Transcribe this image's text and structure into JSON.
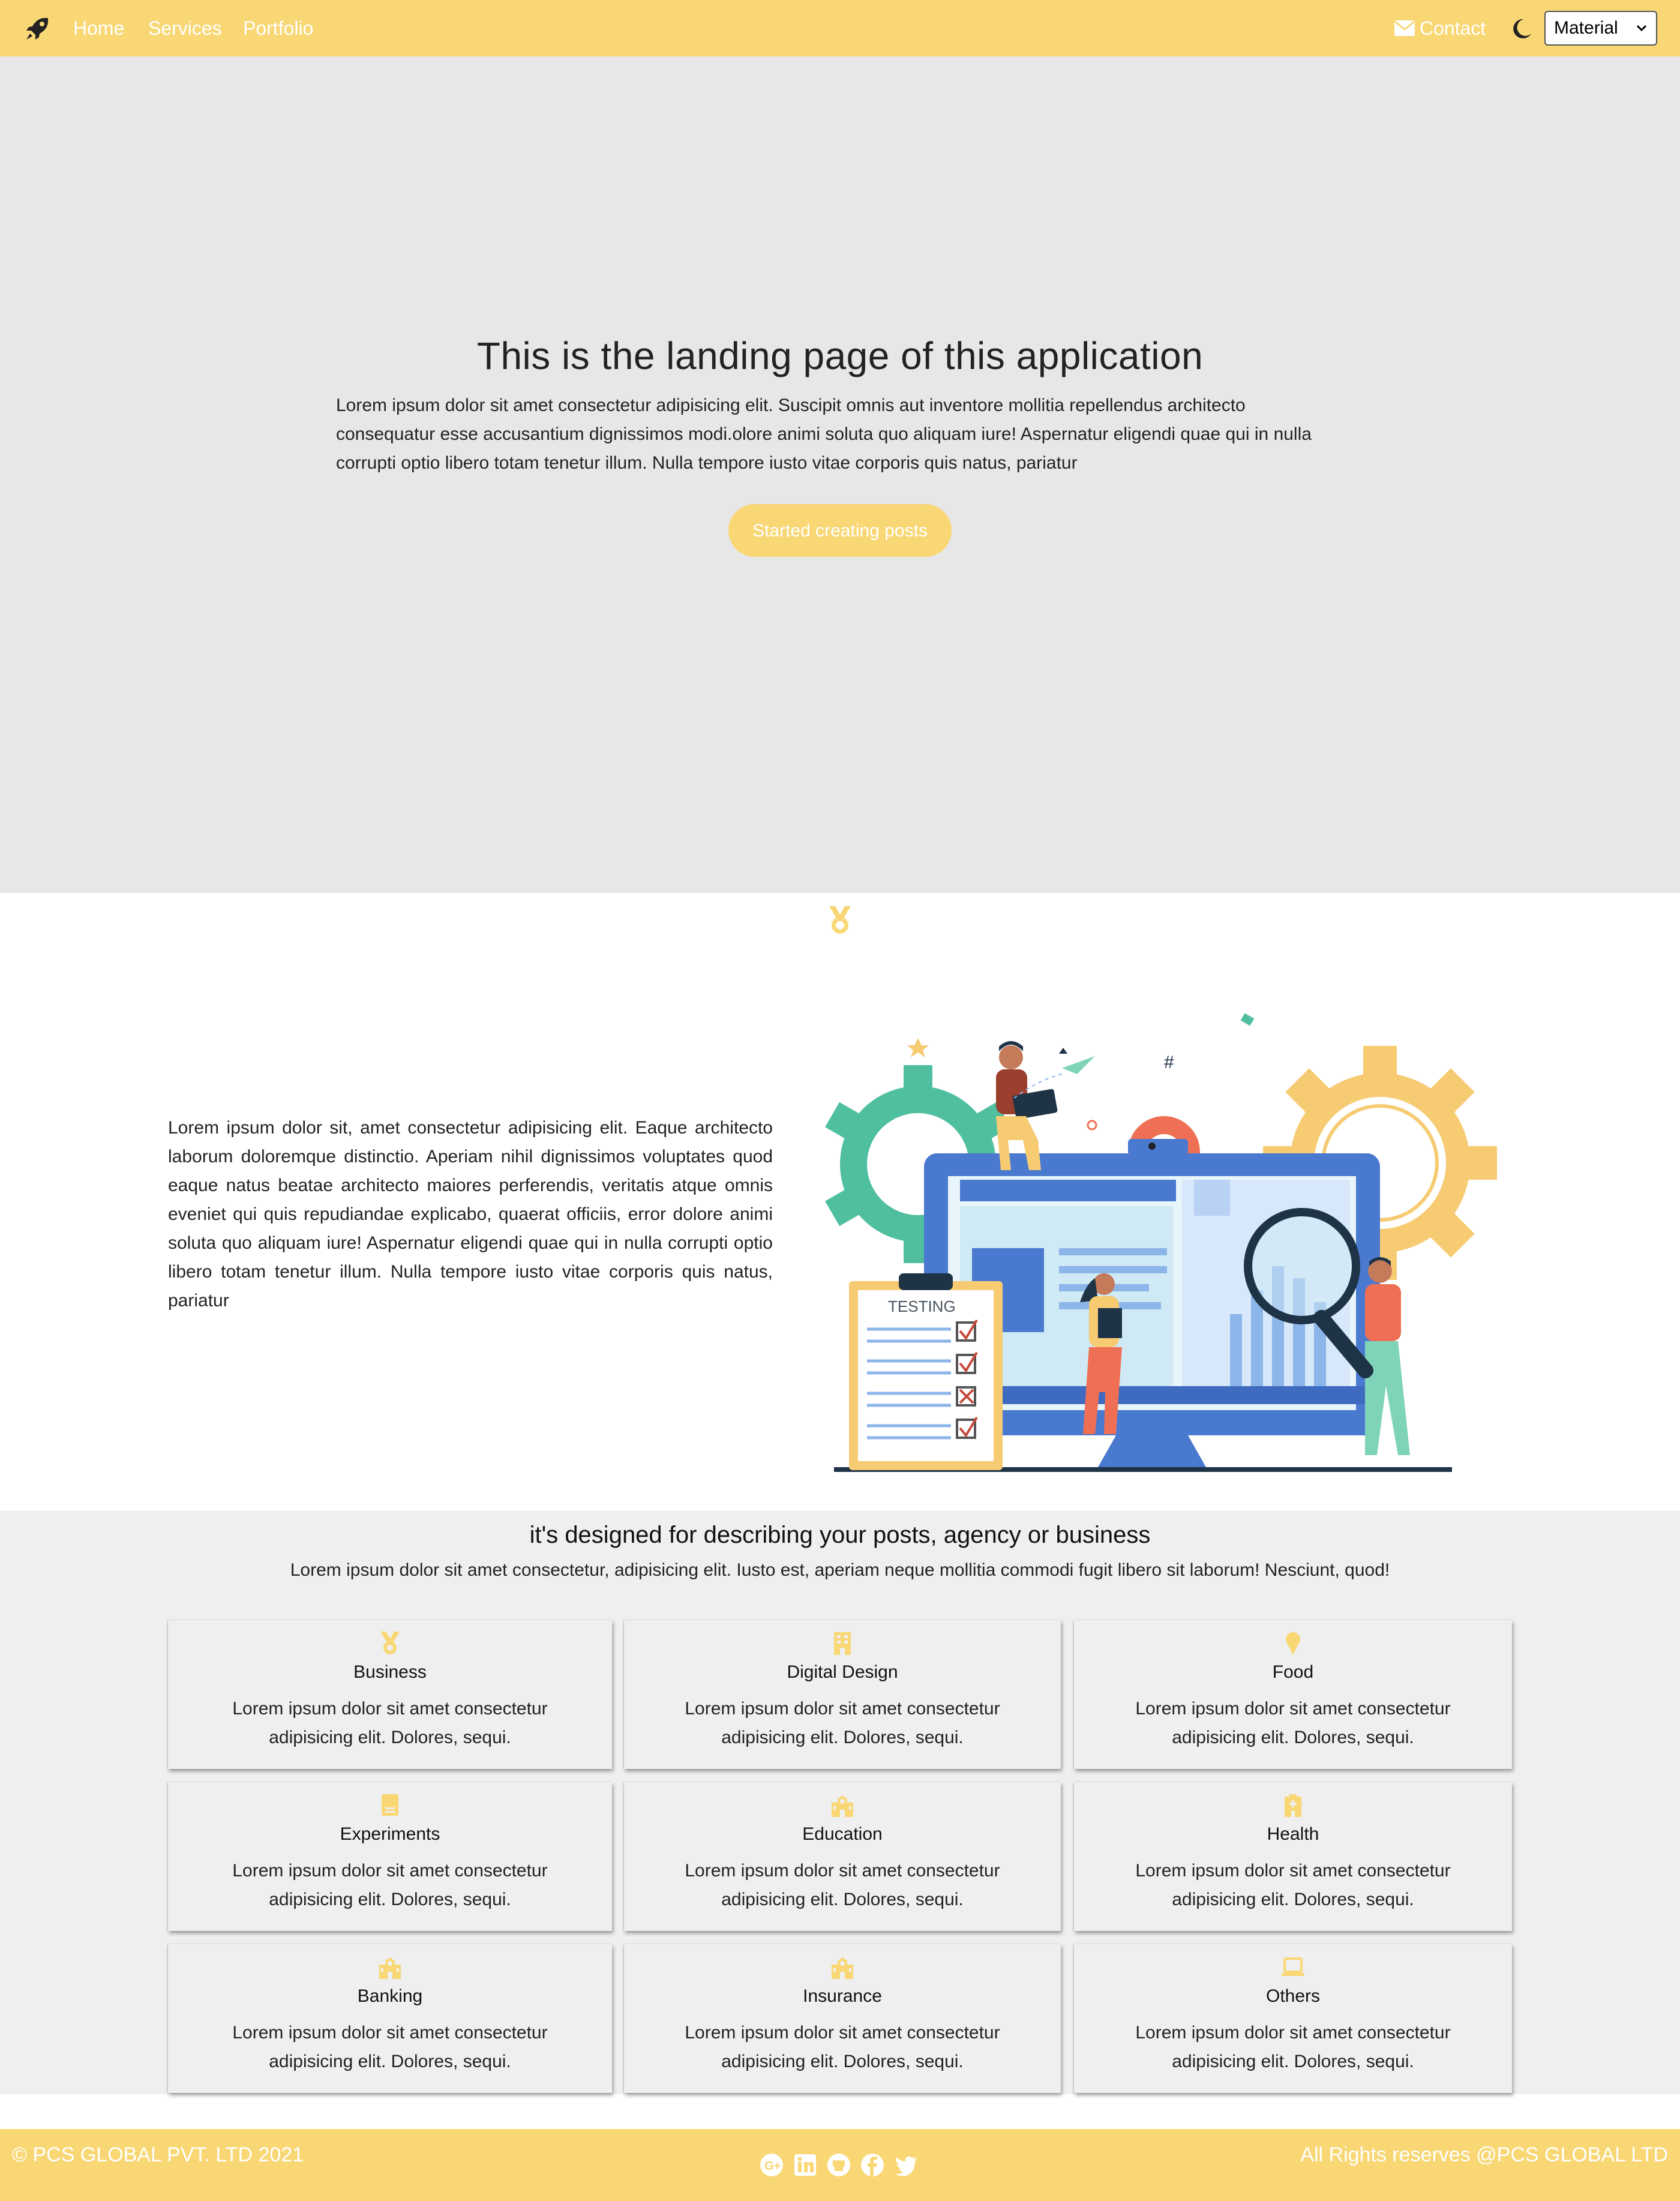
{
  "nav": {
    "home": "Home",
    "services": "Services",
    "portfolio": "Portfolio",
    "contact": "Contact",
    "theme_value": "Material",
    "brand_icon": "rocket-icon"
  },
  "hero": {
    "title": "This is the landing page of this application",
    "text": "Lorem ipsum dolor sit amet consectetur adipisicing elit. Suscipit omnis aut inventore mollitia repellendus architecto consequatur esse accusantium dignissimos modi.olore animi soluta quo aliquam iure! Aspernatur eligendi quae qui in nulla corrupti optio libero totam tenetur illum. Nulla tempore iusto vitae corporis quis natus, pariatur",
    "button": "Started creating posts"
  },
  "feature": {
    "text": "Lorem ipsum dolor sit, amet consectetur adipisicing elit. Eaque architecto laborum doloremque distinctio. Aperiam nihil dignissimos voluptates quod eaque natus beatae architecto maiores perferendis, veritatis atque omnis eveniet qui quis repudiandae explicabo, quaerat officiis, error dolore animi soluta quo aliquam iure! Aspernatur eligendi quae qui in nulla corrupti optio libero totam tenetur illum. Nulla tempore iusto vitae corporis quis natus, pariatur",
    "illustration_label": "TESTING"
  },
  "services": {
    "title": "it's designed for describing your posts, agency or business",
    "subtitle": "Lorem ipsum dolor sit amet consectetur, adipisicing elit. Iusto est, aperiam neque mollitia commodi fugit libero sit laborum! Nesciunt, quod!",
    "cards": [
      {
        "title": "Business",
        "text": "Lorem ipsum dolor sit amet consectetur adipisicing elit. Dolores, sequi.",
        "icon": "medal-icon"
      },
      {
        "title": "Digital Design",
        "text": "Lorem ipsum dolor sit amet consectetur adipisicing elit. Dolores, sequi.",
        "icon": "building-icon"
      },
      {
        "title": "Food",
        "text": "Lorem ipsum dolor sit amet consectetur adipisicing elit. Dolores, sequi.",
        "icon": "ice-cream-icon"
      },
      {
        "title": "Experiments",
        "text": "Lorem ipsum dolor sit amet consectetur adipisicing elit. Dolores, sequi.",
        "icon": "book-icon"
      },
      {
        "title": "Education",
        "text": "Lorem ipsum dolor sit amet consectetur adipisicing elit. Dolores, sequi.",
        "icon": "school-icon"
      },
      {
        "title": "Health",
        "text": "Lorem ipsum dolor sit amet consectetur adipisicing elit. Dolores, sequi.",
        "icon": "hospital-icon"
      },
      {
        "title": "Banking",
        "text": "Lorem ipsum dolor sit amet consectetur adipisicing elit. Dolores, sequi.",
        "icon": "school-icon"
      },
      {
        "title": "Insurance",
        "text": "Lorem ipsum dolor sit amet consectetur adipisicing elit. Dolores, sequi.",
        "icon": "school-icon"
      },
      {
        "title": "Others",
        "text": "Lorem ipsum dolor sit amet consectetur adipisicing elit. Dolores, sequi.",
        "icon": "laptop-icon"
      }
    ]
  },
  "footer": {
    "copyright": "© PCS GLOBAL PVT. LTD 2021",
    "rights": "All Rights reserves @PCS GLOBAL LTD",
    "social": [
      "google-plus-icon",
      "linkedin-icon",
      "github-icon",
      "facebook-icon",
      "twitter-icon"
    ]
  },
  "colors": {
    "accent": "#f8d774",
    "hero_bg": "#e7e7e7",
    "services_bg": "#efefef",
    "text": "#222222"
  }
}
